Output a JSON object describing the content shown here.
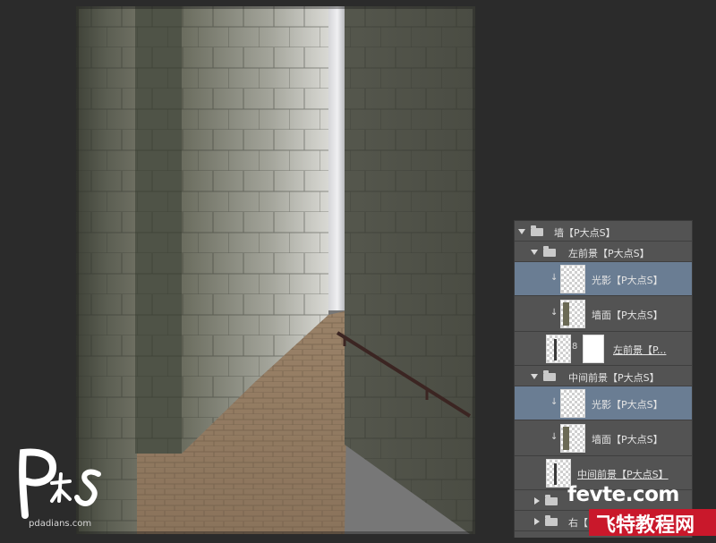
{
  "layers_panel": {
    "rows": [
      {
        "label": "墙【P大点S】",
        "type": "group",
        "expanded": true
      },
      {
        "label": "左前景【P大点S】",
        "type": "group",
        "expanded": true
      },
      {
        "label": "光影【P大点S】",
        "type": "layer",
        "selected": true
      },
      {
        "label": "墙面【P大点S】",
        "type": "layer",
        "selected": false
      },
      {
        "label": "左前景【P...",
        "type": "masked-layer"
      },
      {
        "label": "中间前景【P大点S】",
        "type": "group",
        "expanded": true
      },
      {
        "label": "光影【P大点S】",
        "type": "layer",
        "selected": true
      },
      {
        "label": "墙面【P大点S】",
        "type": "layer",
        "selected": false
      },
      {
        "label": "中间前景【P大点S】",
        "type": "layer"
      },
      {
        "label": "",
        "type": "group",
        "expanded": false
      },
      {
        "label": "右【P",
        "type": "group",
        "expanded": false
      }
    ]
  },
  "watermark_ps": {
    "letters": "P大点S",
    "domain": "pdadians.com"
  },
  "watermark_site": {
    "line1": "fevte.com",
    "line2": "飞特教程网"
  },
  "colors": {
    "panel": "#535353",
    "selected": "#6a7d93",
    "background": "#2b2b2b"
  }
}
